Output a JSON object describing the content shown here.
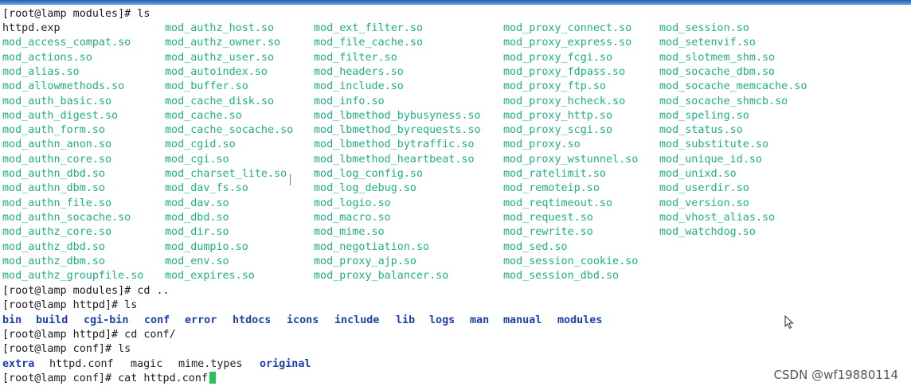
{
  "terminal": {
    "prompt_modules_ls": "[root@lamp modules]# ls",
    "columns": [
      [
        "httpd.exp",
        "mod_access_compat.so",
        "mod_actions.so",
        "mod_alias.so",
        "mod_allowmethods.so",
        "mod_auth_basic.so",
        "mod_auth_digest.so",
        "mod_auth_form.so",
        "mod_authn_anon.so",
        "mod_authn_core.so",
        "mod_authn_dbd.so",
        "mod_authn_dbm.so",
        "mod_authn_file.so",
        "mod_authn_socache.so",
        "mod_authz_core.so",
        "mod_authz_dbd.so",
        "mod_authz_dbm.so",
        "mod_authz_groupfile.so"
      ],
      [
        "mod_authz_host.so",
        "mod_authz_owner.so",
        "mod_authz_user.so",
        "mod_autoindex.so",
        "mod_buffer.so",
        "mod_cache_disk.so",
        "mod_cache.so",
        "mod_cache_socache.so",
        "mod_cgid.so",
        "mod_cgi.so",
        "mod_charset_lite.so",
        "mod_dav_fs.so",
        "mod_dav.so",
        "mod_dbd.so",
        "mod_dir.so",
        "mod_dumpio.so",
        "mod_env.so",
        "mod_expires.so"
      ],
      [
        "mod_ext_filter.so",
        "mod_file_cache.so",
        "mod_filter.so",
        "mod_headers.so",
        "mod_include.so",
        "mod_info.so",
        "mod_lbmethod_bybusyness.so",
        "mod_lbmethod_byrequests.so",
        "mod_lbmethod_bytraffic.so",
        "mod_lbmethod_heartbeat.so",
        "mod_log_config.so",
        "mod_log_debug.so",
        "mod_logio.so",
        "mod_macro.so",
        "mod_mime.so",
        "mod_negotiation.so",
        "mod_proxy_ajp.so",
        "mod_proxy_balancer.so"
      ],
      [
        "mod_proxy_connect.so",
        "mod_proxy_express.so",
        "mod_proxy_fcgi.so",
        "mod_proxy_fdpass.so",
        "mod_proxy_ftp.so",
        "mod_proxy_hcheck.so",
        "mod_proxy_http.so",
        "mod_proxy_scgi.so",
        "mod_proxy.so",
        "mod_proxy_wstunnel.so",
        "mod_ratelimit.so",
        "mod_remoteip.so",
        "mod_reqtimeout.so",
        "mod_request.so",
        "mod_rewrite.so",
        "mod_sed.so",
        "mod_session_cookie.so",
        "mod_session_dbd.so"
      ],
      [
        "mod_session.so",
        "mod_setenvif.so",
        "mod_slotmem_shm.so",
        "mod_socache_dbm.so",
        "mod_socache_memcache.so",
        "mod_socache_shmcb.so",
        "mod_speling.so",
        "mod_status.so",
        "mod_substitute.so",
        "mod_unique_id.so",
        "mod_unixd.so",
        "mod_userdir.so",
        "mod_version.so",
        "mod_vhost_alias.so",
        "mod_watchdog.so"
      ]
    ],
    "cmd_cd_up": "[root@lamp modules]# cd ..",
    "cmd_httpd_ls": "[root@lamp httpd]# ls",
    "httpd_entries": [
      "bin",
      "build",
      "cgi-bin",
      "conf",
      "error",
      "htdocs",
      "icons",
      "include",
      "lib",
      "logs",
      "man",
      "manual",
      "modules"
    ],
    "cmd_cd_conf": "[root@lamp httpd]# cd conf/",
    "cmd_conf_ls": "[root@lamp conf]# ls",
    "conf_entries": [
      {
        "name": "extra",
        "kind": "dir"
      },
      {
        "name": "httpd.conf",
        "kind": "file"
      },
      {
        "name": "magic",
        "kind": "file"
      },
      {
        "name": "mime.types",
        "kind": "file"
      },
      {
        "name": "original",
        "kind": "dir"
      }
    ],
    "cmd_cat": "[root@lamp conf]# cat httpd.conf"
  },
  "colors": {
    "shared_object": "#1fae86",
    "directory": "#1b3fae",
    "plain_file": "#222222",
    "cursor": "#22c55e"
  },
  "watermark": "CSDN @wf19880114"
}
